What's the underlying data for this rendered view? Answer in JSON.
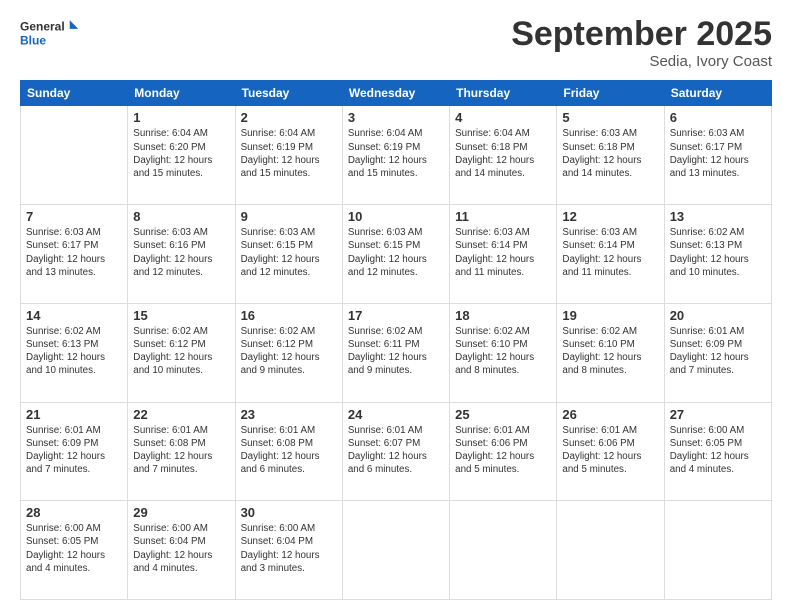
{
  "header": {
    "logo_line1": "General",
    "logo_line2": "Blue",
    "title": "September 2025",
    "subtitle": "Sedia, Ivory Coast"
  },
  "days_of_week": [
    "Sunday",
    "Monday",
    "Tuesday",
    "Wednesday",
    "Thursday",
    "Friday",
    "Saturday"
  ],
  "weeks": [
    [
      {
        "day": "",
        "info": ""
      },
      {
        "day": "1",
        "info": "Sunrise: 6:04 AM\nSunset: 6:20 PM\nDaylight: 12 hours\nand 15 minutes."
      },
      {
        "day": "2",
        "info": "Sunrise: 6:04 AM\nSunset: 6:19 PM\nDaylight: 12 hours\nand 15 minutes."
      },
      {
        "day": "3",
        "info": "Sunrise: 6:04 AM\nSunset: 6:19 PM\nDaylight: 12 hours\nand 15 minutes."
      },
      {
        "day": "4",
        "info": "Sunrise: 6:04 AM\nSunset: 6:18 PM\nDaylight: 12 hours\nand 14 minutes."
      },
      {
        "day": "5",
        "info": "Sunrise: 6:03 AM\nSunset: 6:18 PM\nDaylight: 12 hours\nand 14 minutes."
      },
      {
        "day": "6",
        "info": "Sunrise: 6:03 AM\nSunset: 6:17 PM\nDaylight: 12 hours\nand 13 minutes."
      }
    ],
    [
      {
        "day": "7",
        "info": "Sunrise: 6:03 AM\nSunset: 6:17 PM\nDaylight: 12 hours\nand 13 minutes."
      },
      {
        "day": "8",
        "info": "Sunrise: 6:03 AM\nSunset: 6:16 PM\nDaylight: 12 hours\nand 12 minutes."
      },
      {
        "day": "9",
        "info": "Sunrise: 6:03 AM\nSunset: 6:15 PM\nDaylight: 12 hours\nand 12 minutes."
      },
      {
        "day": "10",
        "info": "Sunrise: 6:03 AM\nSunset: 6:15 PM\nDaylight: 12 hours\nand 12 minutes."
      },
      {
        "day": "11",
        "info": "Sunrise: 6:03 AM\nSunset: 6:14 PM\nDaylight: 12 hours\nand 11 minutes."
      },
      {
        "day": "12",
        "info": "Sunrise: 6:03 AM\nSunset: 6:14 PM\nDaylight: 12 hours\nand 11 minutes."
      },
      {
        "day": "13",
        "info": "Sunrise: 6:02 AM\nSunset: 6:13 PM\nDaylight: 12 hours\nand 10 minutes."
      }
    ],
    [
      {
        "day": "14",
        "info": "Sunrise: 6:02 AM\nSunset: 6:13 PM\nDaylight: 12 hours\nand 10 minutes."
      },
      {
        "day": "15",
        "info": "Sunrise: 6:02 AM\nSunset: 6:12 PM\nDaylight: 12 hours\nand 10 minutes."
      },
      {
        "day": "16",
        "info": "Sunrise: 6:02 AM\nSunset: 6:12 PM\nDaylight: 12 hours\nand 9 minutes."
      },
      {
        "day": "17",
        "info": "Sunrise: 6:02 AM\nSunset: 6:11 PM\nDaylight: 12 hours\nand 9 minutes."
      },
      {
        "day": "18",
        "info": "Sunrise: 6:02 AM\nSunset: 6:10 PM\nDaylight: 12 hours\nand 8 minutes."
      },
      {
        "day": "19",
        "info": "Sunrise: 6:02 AM\nSunset: 6:10 PM\nDaylight: 12 hours\nand 8 minutes."
      },
      {
        "day": "20",
        "info": "Sunrise: 6:01 AM\nSunset: 6:09 PM\nDaylight: 12 hours\nand 7 minutes."
      }
    ],
    [
      {
        "day": "21",
        "info": "Sunrise: 6:01 AM\nSunset: 6:09 PM\nDaylight: 12 hours\nand 7 minutes."
      },
      {
        "day": "22",
        "info": "Sunrise: 6:01 AM\nSunset: 6:08 PM\nDaylight: 12 hours\nand 7 minutes."
      },
      {
        "day": "23",
        "info": "Sunrise: 6:01 AM\nSunset: 6:08 PM\nDaylight: 12 hours\nand 6 minutes."
      },
      {
        "day": "24",
        "info": "Sunrise: 6:01 AM\nSunset: 6:07 PM\nDaylight: 12 hours\nand 6 minutes."
      },
      {
        "day": "25",
        "info": "Sunrise: 6:01 AM\nSunset: 6:06 PM\nDaylight: 12 hours\nand 5 minutes."
      },
      {
        "day": "26",
        "info": "Sunrise: 6:01 AM\nSunset: 6:06 PM\nDaylight: 12 hours\nand 5 minutes."
      },
      {
        "day": "27",
        "info": "Sunrise: 6:00 AM\nSunset: 6:05 PM\nDaylight: 12 hours\nand 4 minutes."
      }
    ],
    [
      {
        "day": "28",
        "info": "Sunrise: 6:00 AM\nSunset: 6:05 PM\nDaylight: 12 hours\nand 4 minutes."
      },
      {
        "day": "29",
        "info": "Sunrise: 6:00 AM\nSunset: 6:04 PM\nDaylight: 12 hours\nand 4 minutes."
      },
      {
        "day": "30",
        "info": "Sunrise: 6:00 AM\nSunset: 6:04 PM\nDaylight: 12 hours\nand 3 minutes."
      },
      {
        "day": "",
        "info": ""
      },
      {
        "day": "",
        "info": ""
      },
      {
        "day": "",
        "info": ""
      },
      {
        "day": "",
        "info": ""
      }
    ]
  ]
}
